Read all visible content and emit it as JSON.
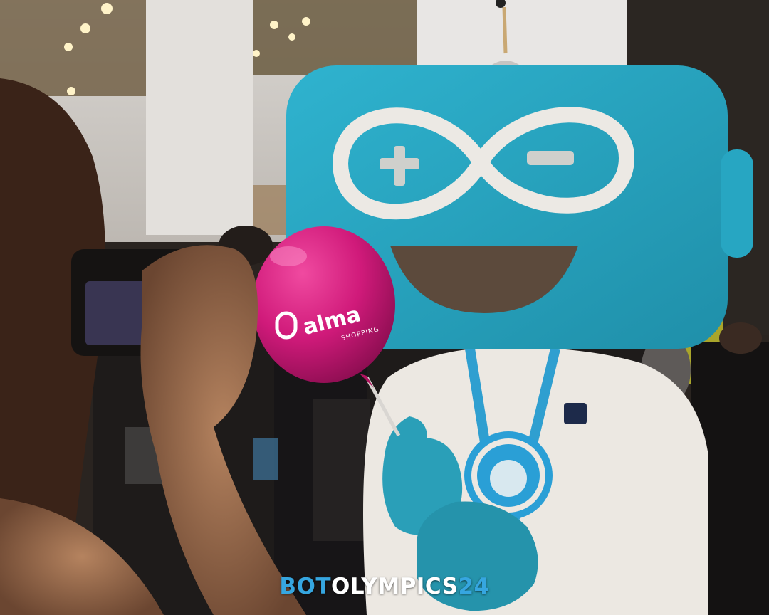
{
  "photo": {
    "description_free": true,
    "balloon": {
      "brand": "alma",
      "sub": "SHOPPING",
      "color": "#d01a7a"
    },
    "mascot_colors": {
      "head": "#27a6c2",
      "ring": "#ece9e4",
      "hoodie": "#ece8e2",
      "glove": "#2a9fb8"
    },
    "watermark": {
      "part1": "BOT",
      "part2": "OLYMPICS",
      "part3": "24",
      "accent": "#36a6e0"
    }
  }
}
